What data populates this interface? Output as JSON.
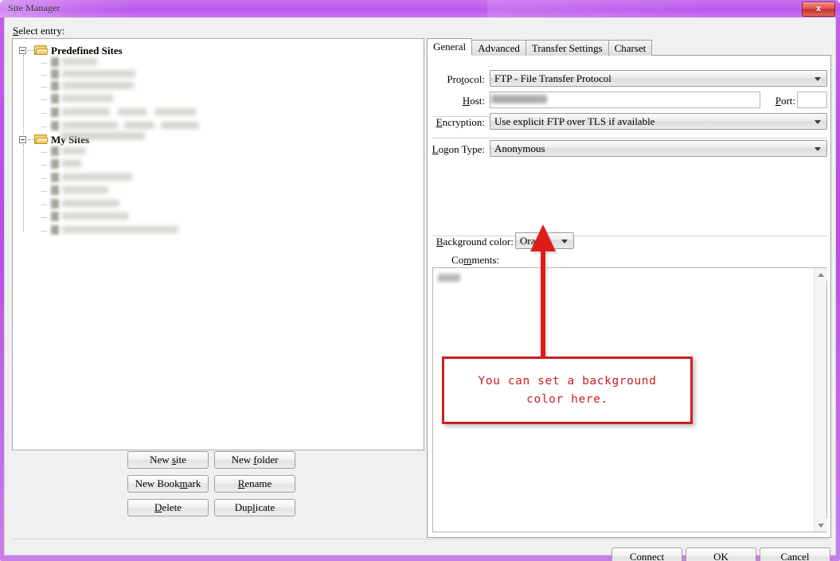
{
  "window": {
    "title": "Site Manager",
    "close_label": "x",
    "frame_color": "#c060ee"
  },
  "left": {
    "select_entry_label": "Select entry:",
    "tree": [
      {
        "label": "Predefined Sites",
        "type": "folder",
        "expanded": true,
        "redacted_children": 6
      },
      {
        "label": "My Sites",
        "type": "folder",
        "expanded": true,
        "redacted_children": 7
      }
    ],
    "buttons": [
      {
        "label": "New site",
        "mnemonic": "s"
      },
      {
        "label": "New folder",
        "mnemonic": "f"
      },
      {
        "label": "New Bookmark",
        "mnemonic": "m"
      },
      {
        "label": "Rename",
        "mnemonic": "R"
      },
      {
        "label": "Delete",
        "mnemonic": "D"
      },
      {
        "label": "Duplicate",
        "mnemonic": "l"
      }
    ]
  },
  "right": {
    "tabs": [
      {
        "label": "General",
        "active": true
      },
      {
        "label": "Advanced",
        "active": false
      },
      {
        "label": "Transfer Settings",
        "active": false
      },
      {
        "label": "Charset",
        "active": false
      }
    ],
    "fields": {
      "protocol_label": "Protocol:",
      "protocol_value": "FTP - File Transfer Protocol",
      "host_label": "Host:",
      "host_value": "",
      "port_label": "Port:",
      "port_value": "",
      "encryption_label": "Encryption:",
      "encryption_value": "Use explicit FTP over TLS if available",
      "logon_type_label": "Logon Type:",
      "logon_type_value": "Anonymous",
      "background_color_label": "Background color:",
      "background_color_value": "Orange",
      "comments_label": "Comments:",
      "comments_value": ""
    }
  },
  "footer": {
    "buttons": [
      {
        "label": "Connect",
        "mnemonic": "C"
      },
      {
        "label": "OK",
        "mnemonic": "O"
      },
      {
        "label": "Cancel",
        "mnemonic": ""
      }
    ]
  },
  "annotation": {
    "text_line1": "You can set a background",
    "text_line2": "color here.",
    "color": "#cc1f20"
  }
}
